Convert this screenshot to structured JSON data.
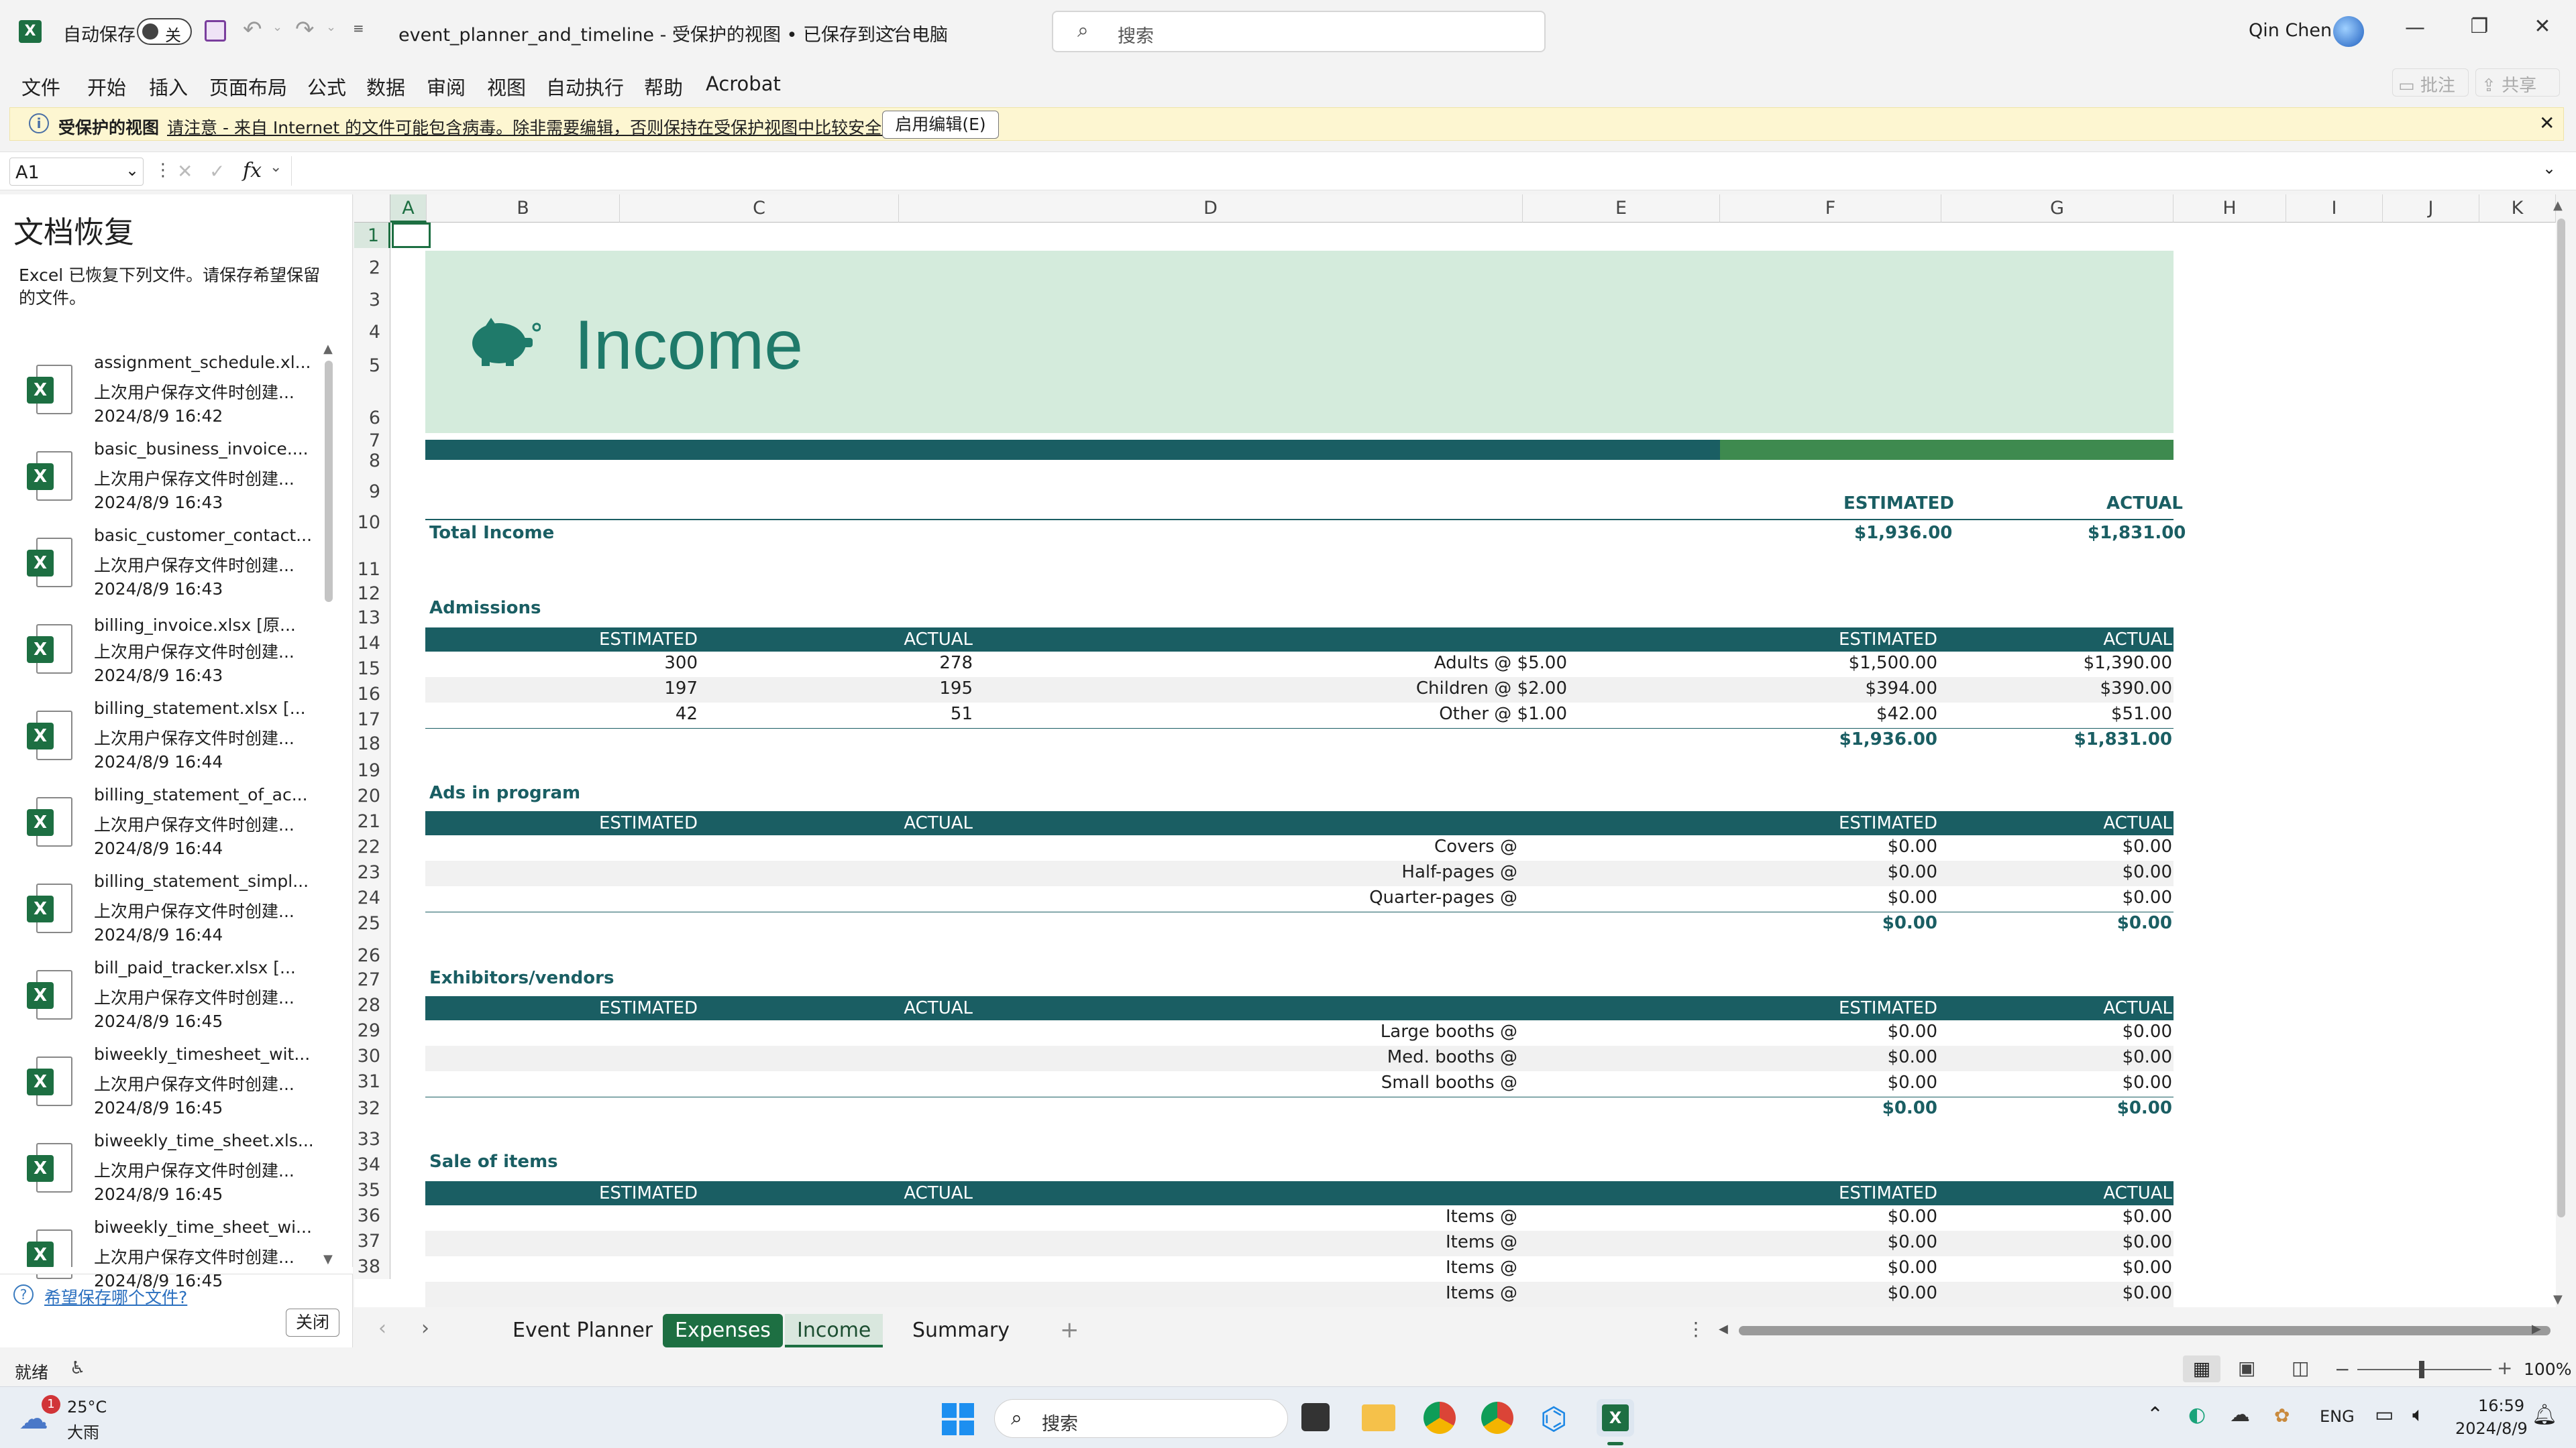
{
  "titlebar": {
    "autosave_label": "自动保存",
    "autosave_state": "关",
    "doc_title": "event_planner_and_timeline  -  受保护的视图 • 已保存到这台电脑",
    "search_placeholder": "搜索",
    "user_name": "Qin Chen"
  },
  "menu": [
    "文件",
    "开始",
    "插入",
    "页面布局",
    "公式",
    "数据",
    "审阅",
    "视图",
    "自动执行",
    "帮助",
    "Acrobat"
  ],
  "ribbon_right": {
    "comments": "批注",
    "share": "共享"
  },
  "protected": {
    "title": "受保护的视图",
    "message": "请注意 - 来自 Internet 的文件可能包含病毒。除非需要编辑，否则保持在受保护视图中比较安全。",
    "button": "启用编辑(E)"
  },
  "formula_bar": {
    "name_box": "A1",
    "fx": "fx",
    "value": ""
  },
  "recovery": {
    "title": "文档恢复",
    "subtitle": "Excel 已恢复下列文件。请保存希望保留的文件。",
    "items": [
      {
        "name": "assignment_schedule.xl...",
        "desc": "上次用户保存文件时创建...",
        "time": "2024/8/9 16:42"
      },
      {
        "name": "basic_business_invoice....",
        "desc": "上次用户保存文件时创建...",
        "time": "2024/8/9 16:43"
      },
      {
        "name": "basic_customer_contact...",
        "desc": "上次用户保存文件时创建...",
        "time": "2024/8/9 16:43"
      },
      {
        "name": "billing_invoice.xlsx  [原...",
        "desc": "上次用户保存文件时创建...",
        "time": "2024/8/9 16:43"
      },
      {
        "name": "billing_statement.xlsx  [...",
        "desc": "上次用户保存文件时创建...",
        "time": "2024/8/9 16:44"
      },
      {
        "name": "billing_statement_of_ac...",
        "desc": "上次用户保存文件时创建...",
        "time": "2024/8/9 16:44"
      },
      {
        "name": "billing_statement_simpl...",
        "desc": "上次用户保存文件时创建...",
        "time": "2024/8/9 16:44"
      },
      {
        "name": "bill_paid_tracker.xlsx  [...",
        "desc": "上次用户保存文件时创建...",
        "time": "2024/8/9 16:45"
      },
      {
        "name": "biweekly_timesheet_wit...",
        "desc": "上次用户保存文件时创建...",
        "time": "2024/8/9 16:45"
      },
      {
        "name": "biweekly_time_sheet.xls...",
        "desc": "上次用户保存文件时创建...",
        "time": "2024/8/9 16:45"
      },
      {
        "name": "biweekly_time_sheet_wi...",
        "desc": "上次用户保存文件时创建...",
        "time": "2024/8/9 16:45"
      }
    ],
    "question": "希望保存哪个文件?",
    "close": "关闭"
  },
  "grid": {
    "columns": [
      "A",
      "B",
      "C",
      "D",
      "E",
      "F",
      "G",
      "H",
      "I",
      "J",
      "K"
    ],
    "rows": [
      "1",
      "2",
      "3",
      "4",
      "5",
      "6",
      "7",
      "8",
      "9",
      "10",
      "11",
      "12",
      "13",
      "14",
      "15",
      "16",
      "17",
      "18",
      "19",
      "20",
      "21",
      "22",
      "23",
      "24",
      "25",
      "26",
      "27",
      "28",
      "29",
      "30",
      "31",
      "32",
      "33",
      "34",
      "35",
      "36",
      "37",
      "38"
    ]
  },
  "sheet": {
    "title": "Income",
    "estimated": "ESTIMATED",
    "actual": "ACTUAL",
    "total_income_label": "Total Income",
    "total_income_est": "$1,936.00",
    "total_income_act": "$1,831.00",
    "admissions": {
      "title": "Admissions",
      "rows": [
        {
          "est_qty": "300",
          "act_qty": "278",
          "label": "Adults @ $5.00",
          "est": "$1,500.00",
          "act": "$1,390.00"
        },
        {
          "est_qty": "197",
          "act_qty": "195",
          "label": "Children @ $2.00",
          "est": "$394.00",
          "act": "$390.00"
        },
        {
          "est_qty": "42",
          "act_qty": "51",
          "label": "Other @ $1.00",
          "est": "$42.00",
          "act": "$51.00"
        }
      ],
      "total_est": "$1,936.00",
      "total_act": "$1,831.00"
    },
    "ads": {
      "title": "Ads in program",
      "rows": [
        {
          "label": "Covers @",
          "est": "$0.00",
          "act": "$0.00"
        },
        {
          "label": "Half-pages @",
          "est": "$0.00",
          "act": "$0.00"
        },
        {
          "label": "Quarter-pages @",
          "est": "$0.00",
          "act": "$0.00"
        }
      ],
      "total_est": "$0.00",
      "total_act": "$0.00"
    },
    "exhibitors": {
      "title": "Exhibitors/vendors",
      "rows": [
        {
          "label": "Large booths @",
          "est": "$0.00",
          "act": "$0.00"
        },
        {
          "label": "Med. booths @",
          "est": "$0.00",
          "act": "$0.00"
        },
        {
          "label": "Small booths @",
          "est": "$0.00",
          "act": "$0.00"
        }
      ],
      "total_est": "$0.00",
      "total_act": "$0.00"
    },
    "sale": {
      "title": "Sale of items",
      "rows": [
        {
          "label": "Items @",
          "est": "$0.00",
          "act": "$0.00"
        },
        {
          "label": "Items @",
          "est": "$0.00",
          "act": "$0.00"
        },
        {
          "label": "Items @",
          "est": "$0.00",
          "act": "$0.00"
        },
        {
          "label": "Items @",
          "est": "$0.00",
          "act": "$0.00"
        }
      ]
    }
  },
  "tabs": [
    "Event Planner",
    "Expenses",
    "Income",
    "Summary"
  ],
  "status": {
    "ready": "就绪",
    "zoom": "100%"
  },
  "taskbar": {
    "weather_temp": "25°C",
    "weather_desc": "大雨",
    "weather_badge": "1",
    "search": "搜索",
    "lang": "ENG",
    "time": "16:59",
    "date": "2024/8/9"
  },
  "colors": {
    "teal": "#1a5e63",
    "green": "#3e8a4f",
    "mint": "#d4ebdc",
    "excel": "#1d6f42"
  }
}
